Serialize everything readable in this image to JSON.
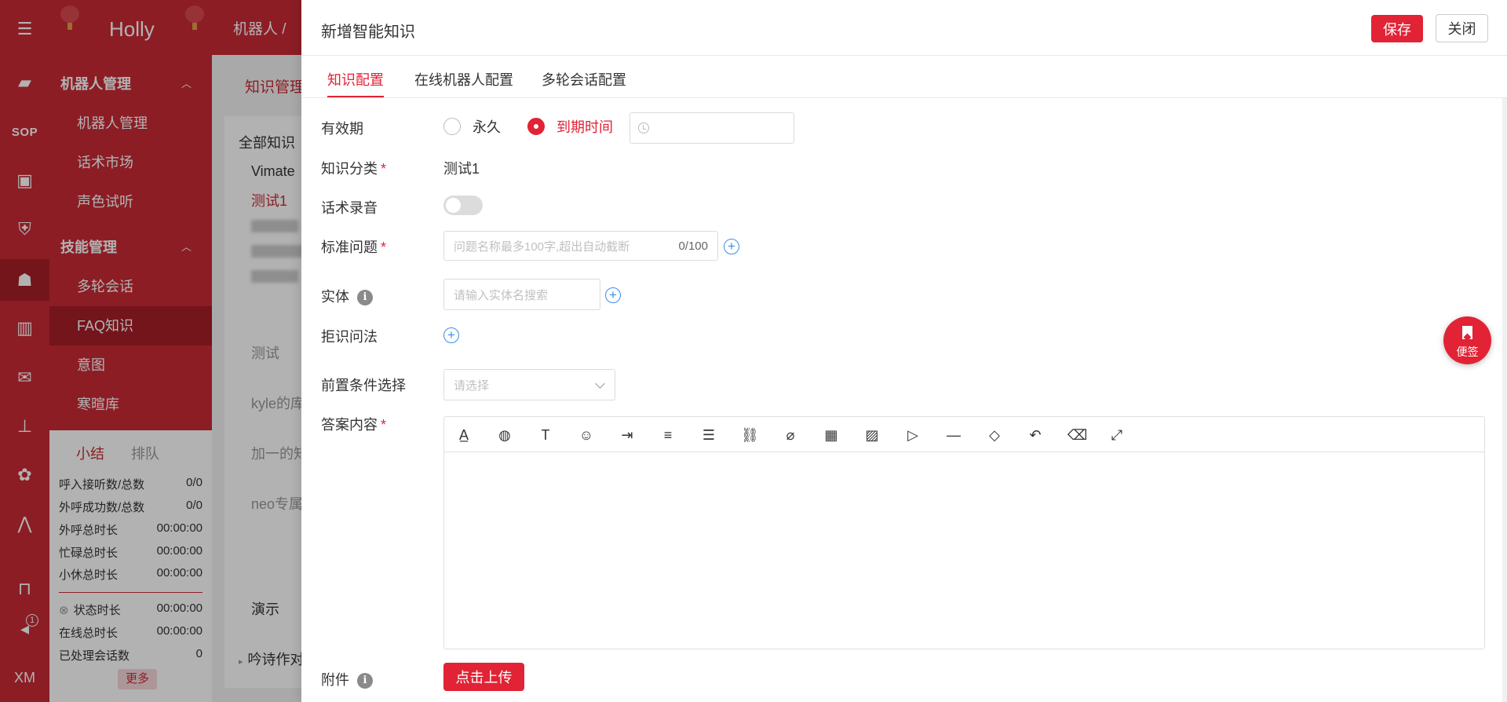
{
  "app": {
    "brand": "Holly",
    "breadcrumb": "机器人 /",
    "rail_label": "XM",
    "notification_count": "1"
  },
  "sidebar": {
    "group1": "机器人管理",
    "group1_items": [
      "机器人管理",
      "话术市场",
      "声色试听"
    ],
    "group2": "技能管理",
    "group2_items": [
      "多轮会话",
      "FAQ知识",
      "意图",
      "寒暄库"
    ]
  },
  "stats": {
    "tab_summary": "小结",
    "tab_queue": "排队",
    "rows": [
      {
        "label": "呼入接听数/总数",
        "value": "0/0"
      },
      {
        "label": "外呼成功数/总数",
        "value": "0/0"
      },
      {
        "label": "外呼总时长",
        "value": "00:00:00"
      },
      {
        "label": "忙碌总时长",
        "value": "00:00:00"
      },
      {
        "label": "小休总时长",
        "value": "00:00:00"
      },
      {
        "label": "状态时长",
        "value": "00:00:00"
      },
      {
        "label": "在线总时长",
        "value": "00:00:00"
      },
      {
        "label": "已处理会话数",
        "value": "0"
      }
    ],
    "more": "更多"
  },
  "background": {
    "tab": "知识管理",
    "tree_header": "全部知识",
    "tree_items": [
      "Vimate",
      "测试1",
      "测试",
      "kyle的库",
      "加一的知",
      "neo专属",
      "演示",
      "吟诗作对"
    ]
  },
  "drawer": {
    "title": "新增智能知识",
    "save": "保存",
    "close": "关闭",
    "tabs": [
      "知识配置",
      "在线机器人配置",
      "多轮会话配置"
    ],
    "validity": {
      "label": "有效期",
      "opt_forever": "永久",
      "opt_expire": "到期时间"
    },
    "category": {
      "label": "知识分类",
      "value": "测试1"
    },
    "recording": {
      "label": "话术录音"
    },
    "question": {
      "label": "标准问题",
      "placeholder": "问题名称最多100字,超出自动截断",
      "counter": "0/100"
    },
    "entity": {
      "label": "实体",
      "placeholder": "请输入实体名搜索"
    },
    "reject": {
      "label": "拒识问法"
    },
    "precondition": {
      "label": "前置条件选择",
      "placeholder": "请选择"
    },
    "answer": {
      "label": "答案内容"
    },
    "attachment": {
      "label": "附件",
      "upload": "点击上传"
    },
    "required_mark": "*",
    "info_mark": "i"
  },
  "sticky_note": {
    "label": "便签"
  },
  "colors": {
    "brand_red": "#c92a36",
    "accent_red": "#e12335",
    "link_blue": "#3a8ee6"
  }
}
